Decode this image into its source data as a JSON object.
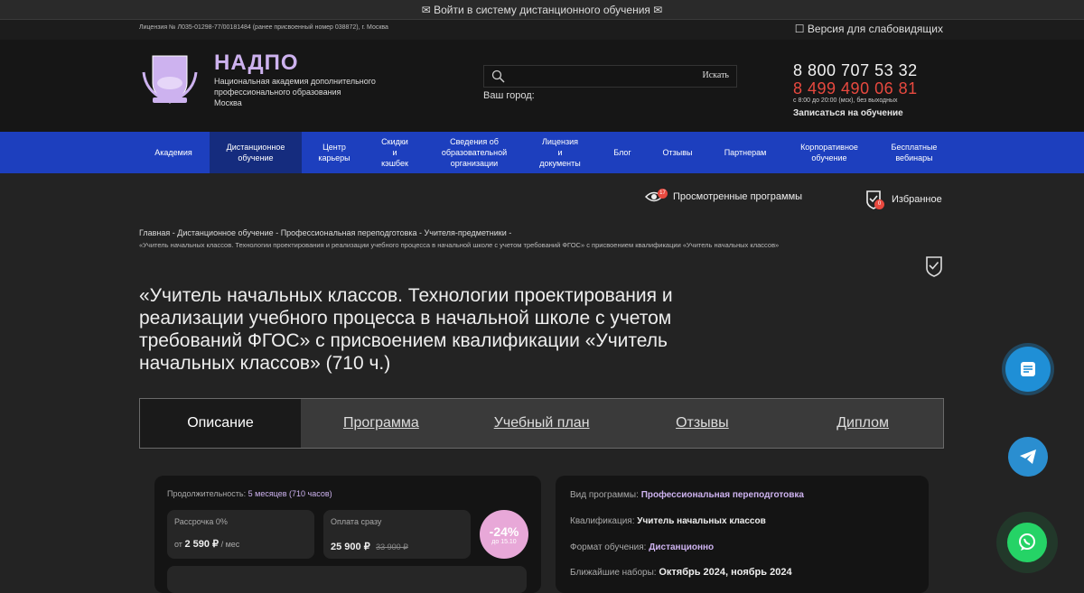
{
  "topbar": {
    "text": "✉ Войти в систему дистанционного обучения ✉"
  },
  "licbar": {
    "license": "Лицензия № Л035-01298-77/00181484 (ранее присвоенный номер 038872), г. Москва",
    "vision": "☐ Версия для слабовидящих"
  },
  "header": {
    "brand": "НАДПО",
    "sub1": "Национальная академия дополнительного",
    "sub2": "профессионального образования",
    "sub3": "Москва",
    "search_button": "Искать",
    "search_placeholder": "",
    "city_label": "Ваш город:",
    "phone1": "8 800 707 53 32",
    "phone2": "8 499 490 06 81",
    "hours": "с 8:00 до 20:00 (мск), без выходных",
    "enroll": "Записаться на обучение"
  },
  "nav": {
    "items": [
      [
        "Академия"
      ],
      [
        "Дистанционное",
        "обучение"
      ],
      [
        "Центр",
        "карьеры"
      ],
      [
        "Скидки",
        "и",
        "кэшбек"
      ],
      [
        "Сведения об",
        "образовательной",
        "организации"
      ],
      [
        "Лицензия",
        "и",
        "документы"
      ],
      [
        "Блог"
      ],
      [
        "Отзывы"
      ],
      [
        "Партнерам"
      ],
      [
        "Корпоративное",
        "обучение"
      ],
      [
        "Бесплатные",
        "вебинары"
      ]
    ]
  },
  "utility": {
    "viewed_label": "Просмотренные программы",
    "viewed_count": "17",
    "favorites_label": "Избранное",
    "favorites_count": "0"
  },
  "breadcrumb": {
    "items": [
      "Главная",
      "Дистанционное обучение",
      "Профессиональная переподготовка",
      "Учителя-предметники"
    ],
    "current": "«Учитель начальных классов. Технологии проектирования и реализации учебного процесса в начальной школе с учетом требований ФГОС» с присвоением квалификации «Учитель начальных классов»"
  },
  "course": {
    "title": "«Учитель начальных классов. Технологии проектирования и реализации учебного процесса в начальной школе с учетом требований ФГОС» с присвоением квалификации «Учитель начальных классов» (710 ч.)"
  },
  "tabs": [
    "Описание",
    "Программа",
    "Учебный план",
    "Отзывы",
    "Диплом"
  ],
  "pricing": {
    "duration_label": "Продолжительность:",
    "duration_value": "5 месяцев (710 часов)",
    "installment_label": "Рассрочка 0%",
    "installment_prefix": "от",
    "installment_value": "2 590 ₽",
    "installment_suffix": "/ мес",
    "pay_label": "Оплата сразу",
    "pay_value": "25 900 ₽",
    "pay_old": "33 900 ₽",
    "discount": "-24%",
    "discount_sub": "до 15.10"
  },
  "details": {
    "rows": [
      {
        "label": "Вид программы:",
        "value": "Профессиональная переподготовка"
      },
      {
        "label": "Квалификация:",
        "value": "Учитель начальных классов"
      },
      {
        "label": "Формат обучения:",
        "value": "Дистанционно"
      },
      {
        "label": "Ближайшие наборы:",
        "value": "Октябрь 2024, ноябрь 2024"
      }
    ]
  },
  "colors": {
    "accent_blue": "#1d3fbe",
    "brand_lilac": "#cdb2ef",
    "phone_red": "#e8493f",
    "whatsapp": "#25d366",
    "telegram": "#2a8ed0"
  }
}
